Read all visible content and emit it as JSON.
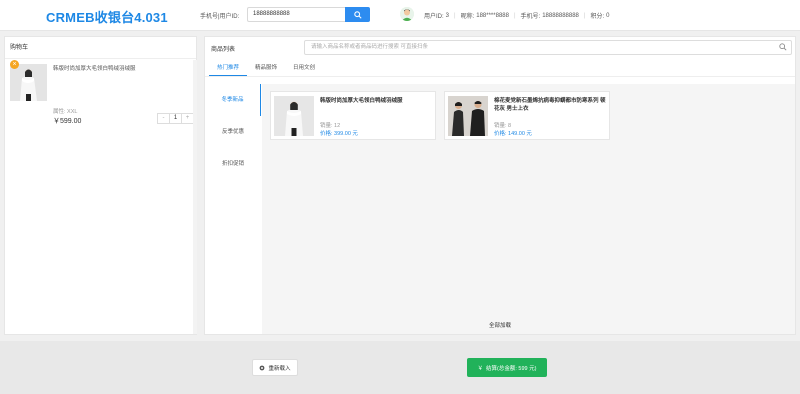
{
  "header": {
    "brand": "CRMEB收银台4.031",
    "search_label": "手机号|用户ID:",
    "search_value": "18888888888",
    "user": {
      "id_label": "用户ID:",
      "id_value": "3",
      "nickname_label": "昵称:",
      "nickname_value": "188****8888",
      "phone_label": "手机号:",
      "phone_value": "18888888888",
      "points_label": "积分:",
      "points_value": "0"
    }
  },
  "cart": {
    "title": "购物车",
    "items": [
      {
        "name": "韩版时尚加厚大毛领白鸭绒羽绒服",
        "attr": "属性: XXL",
        "price": "￥599.00",
        "quantity": "1",
        "minus": "-",
        "plus": "+",
        "remove": "×"
      }
    ]
  },
  "goods": {
    "title": "商品列表",
    "search_placeholder": "请输入商品名称或者商品码进行搜索 可直接扫条",
    "tabs": [
      "热门推荐",
      "精品服饰",
      "日用文创"
    ],
    "active_tab": 0,
    "categories": [
      "冬季新品",
      "反季优惠",
      "折扣促销"
    ],
    "active_category": 0,
    "products": [
      {
        "name": "韩版时尚加厚大毛领白鸭绒羽绒服",
        "sales": "销量: 12",
        "price": "价格: 399.00 元"
      },
      {
        "name": "棉花麦党新石墨烯抗病毒抑螨都市防寒系列 顿花灰 男士上衣",
        "sales": "销量: 8",
        "price": "价格: 149.00 元"
      }
    ],
    "load_all": "全部加载"
  },
  "footer": {
    "reload_label": "重新载入",
    "pay_label": "结算(总金额: 599 元)",
    "pay_currency": "￥"
  },
  "colors": {
    "brand": "#1e88e5",
    "primary": "#2d8cf0",
    "pay": "#21b25a",
    "remove": "#f5a623"
  }
}
